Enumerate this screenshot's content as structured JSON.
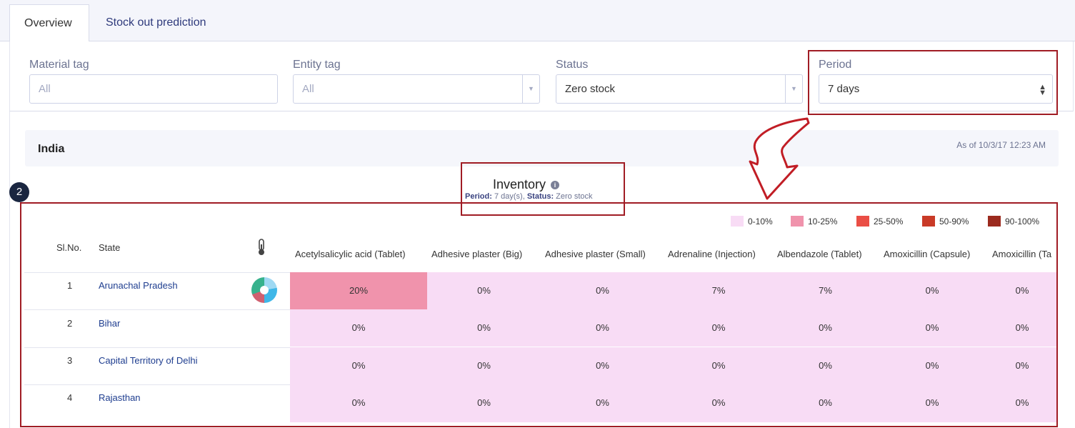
{
  "tabs": [
    {
      "label": "Overview",
      "active": true
    },
    {
      "label": "Stock out prediction",
      "active": false
    }
  ],
  "filters": {
    "material_tag": {
      "label": "Material tag",
      "placeholder": "All"
    },
    "entity_tag": {
      "label": "Entity tag",
      "placeholder": "All"
    },
    "status": {
      "label": "Status",
      "value": "Zero stock"
    },
    "period": {
      "label": "Period",
      "value": "7 days"
    }
  },
  "location": {
    "title": "India",
    "as_of": "As of 10/3/17 12:23 AM"
  },
  "inventory": {
    "title": "Inventory",
    "period_label": "Period:",
    "period_value": "7 day(s),",
    "status_label": "Status:",
    "status_value": "Zero stock"
  },
  "legend": [
    {
      "label": "0-10%",
      "color": "#f8dcf5"
    },
    {
      "label": "10-25%",
      "color": "#f093ac"
    },
    {
      "label": "25-50%",
      "color": "#ea4e45"
    },
    {
      "label": "50-90%",
      "color": "#c93a27"
    },
    {
      "label": "90-100%",
      "color": "#9b2a1e"
    }
  ],
  "table": {
    "sl_header": "Sl.No.",
    "state_header": "State",
    "columns": [
      "Acetylsalicylic acid (Tablet)",
      "Adhesive plaster (Big)",
      "Adhesive plaster (Small)",
      "Adrenaline (Injection)",
      "Albendazole (Tablet)",
      "Amoxicillin (Capsule)",
      "Amoxicillin (Ta"
    ],
    "rows": [
      {
        "sl": "1",
        "state": "Arunachal Pradesh",
        "values": [
          "20%",
          "0%",
          "0%",
          "7%",
          "7%",
          "0%",
          "0%"
        ]
      },
      {
        "sl": "2",
        "state": "Bihar",
        "values": [
          "0%",
          "0%",
          "0%",
          "0%",
          "0%",
          "0%",
          "0%"
        ]
      },
      {
        "sl": "3",
        "state": "Capital Territory of Delhi",
        "values": [
          "0%",
          "0%",
          "0%",
          "0%",
          "0%",
          "0%",
          "0%"
        ]
      },
      {
        "sl": "4",
        "state": "Rajasthan",
        "values": [
          "0%",
          "0%",
          "0%",
          "0%",
          "0%",
          "0%",
          "0%"
        ]
      }
    ]
  },
  "annotation": {
    "badge": "2",
    "color": "#a01c24"
  }
}
